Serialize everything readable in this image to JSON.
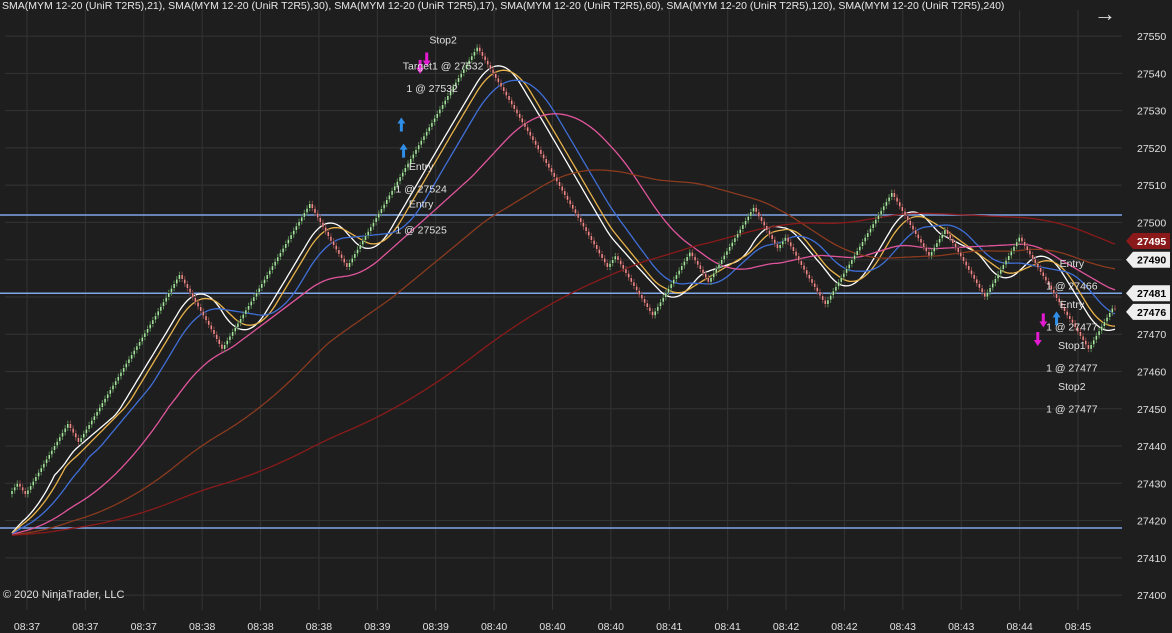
{
  "header": {
    "indicators": "SMA(MYM 12-20 (UniR T2R5),21), SMA(MYM 12-20 (UniR T2R5),30), SMA(MYM 12-20 (UniR T2R5),17), SMA(MYM 12-20 (UniR T2R5),60), SMA(MYM 12-20 (UniR T2R5),120), SMA(MYM 12-20 (UniR T2R5),240)"
  },
  "copyright": "© 2020 NinjaTrader, LLC",
  "colors": {
    "background": "#1e1e1e",
    "grid": "#343434",
    "up": "#a8e6a0",
    "down": "#f08a8a",
    "hline": "#7fa6e8",
    "sma17": "#ffffff",
    "sma21": "#e8b24a",
    "sma30": "#3f6fd8",
    "sma60": "#e0559c",
    "sma120": "#8a3a1e",
    "sma240": "#8a1a1a",
    "buy": "#2f8ee8",
    "sell": "#e21ad0"
  },
  "chart_data": {
    "type": "candlestick",
    "ylim": [
      27396,
      27557
    ],
    "y_ticks": [
      27400,
      27410,
      27420,
      27430,
      27440,
      27450,
      27460,
      27470,
      27480,
      27490,
      27500,
      27510,
      27520,
      27530,
      27540,
      27550
    ],
    "x_labels": [
      "08:37",
      "08:37",
      "08:37",
      "08:38",
      "08:38",
      "08:38",
      "08:39",
      "08:39",
      "08:40",
      "08:40",
      "08:40",
      "08:41",
      "08:41",
      "08:42",
      "08:42",
      "08:43",
      "08:43",
      "08:44",
      "08:45"
    ],
    "price_path": [
      27427,
      27430,
      27427,
      27446,
      27441,
      27461,
      27475,
      27486,
      27470,
      27466,
      27480,
      27505,
      27495,
      27488,
      27500,
      27522,
      27540,
      27547,
      27534,
      27522,
      27506,
      27488,
      27491,
      27484,
      27475,
      27492,
      27484,
      27490,
      27504,
      27493,
      27496,
      27486,
      27478,
      27508,
      27498,
      27491,
      27498,
      27480,
      27496,
      27475,
      27473,
      27466,
      27477,
      27477
    ],
    "horizontal_lines": [
      27502,
      27481,
      27418
    ],
    "price_markers": [
      {
        "value": 27495,
        "bg": "#8a1a1a",
        "fg": "#ffffff"
      },
      {
        "value": 27490,
        "bg": "#eeeeee",
        "fg": "#000000"
      },
      {
        "value": 27481,
        "bg": "#eeeeee",
        "fg": "#000000"
      },
      {
        "value": 27476,
        "bg": "#eeeeee",
        "fg": "#000000"
      }
    ],
    "series": [
      {
        "name": "SMA 17",
        "period": 17,
        "color": "#ffffff"
      },
      {
        "name": "SMA 21",
        "period": 21,
        "color": "#e8b24a"
      },
      {
        "name": "SMA 30",
        "period": 30,
        "color": "#3f6fd8"
      },
      {
        "name": "SMA 60",
        "period": 60,
        "color": "#e0559c"
      },
      {
        "name": "SMA 120",
        "period": 120,
        "color": "#8a3a1e"
      },
      {
        "name": "SMA 240",
        "period": 240,
        "color": "#8a1a1a"
      }
    ],
    "annotations": [
      {
        "lines": [
          "Stop2"
        ],
        "price": 27548,
        "t": 0.38
      },
      {
        "lines": [
          "Target1 @ 27532"
        ],
        "price": 27541,
        "t": 0.38
      },
      {
        "lines": [
          "1 @ 27532"
        ],
        "price": 27535,
        "t": 0.37
      },
      {
        "lines": [
          "Entry"
        ],
        "price": 27514,
        "t": 0.36
      },
      {
        "lines": [
          "1 @ 27524"
        ],
        "price": 27508,
        "t": 0.36
      },
      {
        "lines": [
          "Entry"
        ],
        "price": 27504,
        "t": 0.36
      },
      {
        "lines": [
          "1 @ 27525"
        ],
        "price": 27497,
        "t": 0.36
      },
      {
        "lines": [
          "Entry"
        ],
        "price": 27488,
        "t": 0.95
      },
      {
        "lines": [
          "1 @ 27466"
        ],
        "price": 27482,
        "t": 0.95
      },
      {
        "lines": [
          "Entry"
        ],
        "price": 27477,
        "t": 0.95
      },
      {
        "lines": [
          "1 @ 27477"
        ],
        "price": 27471,
        "t": 0.95
      },
      {
        "lines": [
          "Stop1"
        ],
        "price": 27466,
        "t": 0.95
      },
      {
        "lines": [
          "1 @ 27477"
        ],
        "price": 27460,
        "t": 0.95
      },
      {
        "lines": [
          "Stop2"
        ],
        "price": 27455,
        "t": 0.95
      },
      {
        "lines": [
          "1 @ 27477"
        ],
        "price": 27449,
        "t": 0.95
      }
    ],
    "executions": [
      {
        "type": "buy",
        "price": 27519,
        "t": 0.355
      },
      {
        "type": "buy",
        "price": 27526,
        "t": 0.353
      },
      {
        "type": "sell",
        "price": 27542,
        "t": 0.37
      },
      {
        "type": "sell",
        "price": 27544,
        "t": 0.376
      },
      {
        "type": "sell",
        "price": 27474,
        "t": 0.935
      },
      {
        "type": "sell",
        "price": 27469,
        "t": 0.93
      },
      {
        "type": "buy",
        "price": 27474,
        "t": 0.947
      }
    ]
  }
}
